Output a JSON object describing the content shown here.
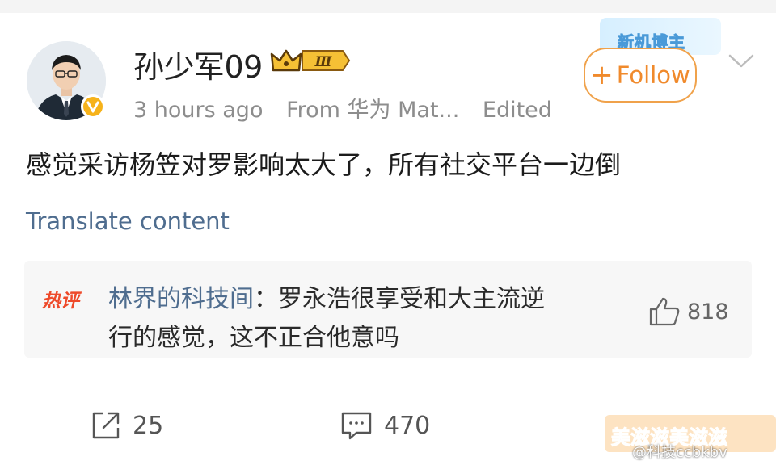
{
  "post": {
    "username": "孙少军09",
    "vip_badge_text": "Ⅲ",
    "time": "3 hours ago",
    "source": "From 华为 Mat...",
    "edited": "Edited",
    "event_badge": "新机博主",
    "follow_label": "Follow",
    "follow_plus": "+",
    "text": "感觉采访杨笠对罗影响太大了，所有社交平台一边倒",
    "translate": "Translate content"
  },
  "hot_comment": {
    "tag": "热评",
    "author": "林界的科技间",
    "separator": "：",
    "line1": "罗永浩很享受和大主流逆",
    "line2": "行的感觉，这不正合他意吗",
    "likes": "818"
  },
  "actions": {
    "repost_count": "25",
    "comment_count": "470"
  },
  "watermark": {
    "sticker": "美滋滋美滋滋",
    "text": "@科技ccbkbv"
  },
  "colors": {
    "accent": "#f08a2c",
    "link": "#4f6d8f",
    "hot": "#ee4a2a",
    "verified": "#f6b21a"
  }
}
